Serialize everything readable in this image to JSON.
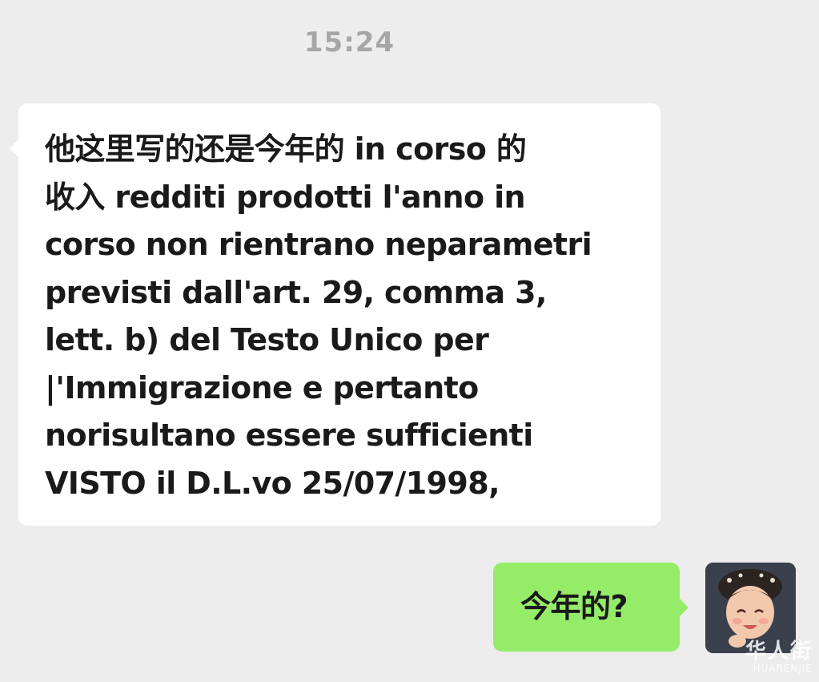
{
  "chat": {
    "timestamp": "15:24",
    "incoming_message": {
      "lines": [
        "他这里写的还是今年的 in corso 的",
        "收入 redditi prodotti l'anno in",
        "corso non rientrano neparametri",
        "previsti dall'art. 29, comma 3,",
        "lett. b) del Testo Unico per",
        "|'Immigrazione e pertanto",
        "norisultano essere sufficienti",
        "VISTO il D.L.vo 25/07/1998,"
      ]
    },
    "outgoing_message": {
      "text": "今年的?"
    },
    "avatar": {
      "icon": "user-avatar-photo"
    }
  },
  "watermark": {
    "text_cn": "华人街",
    "text_en": "HUARENJIE"
  },
  "colors": {
    "background": "#ededed",
    "incoming_bubble": "#ffffff",
    "outgoing_bubble": "#95ec69",
    "timestamp": "#a6a6a6"
  }
}
